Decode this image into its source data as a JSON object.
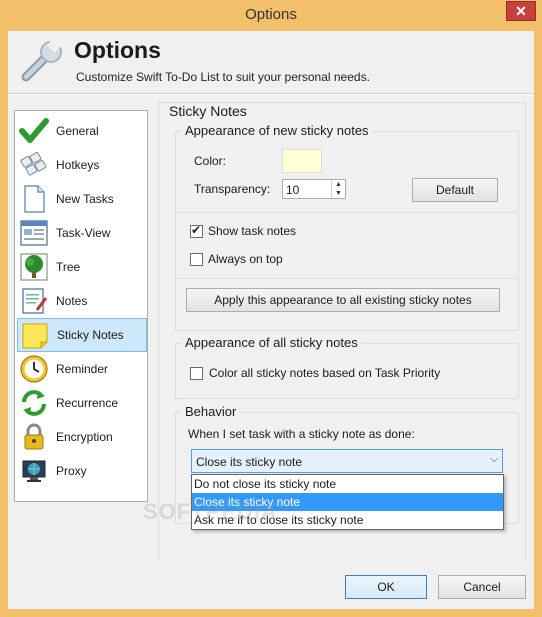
{
  "window": {
    "title": "Options",
    "close_label": "✕"
  },
  "header": {
    "title": "Options",
    "subtitle": "Customize Swift To-Do List to suit your personal needs."
  },
  "nav": {
    "items": [
      {
        "label": "General",
        "icon": "checkmark-icon"
      },
      {
        "label": "Hotkeys",
        "icon": "keyboard-icon"
      },
      {
        "label": "New Tasks",
        "icon": "new-document-icon"
      },
      {
        "label": "Task-View",
        "icon": "task-view-icon"
      },
      {
        "label": "Tree",
        "icon": "tree-icon"
      },
      {
        "label": "Notes",
        "icon": "notes-icon"
      },
      {
        "label": "Sticky Notes",
        "icon": "sticky-note-icon"
      },
      {
        "label": "Reminder",
        "icon": "clock-icon"
      },
      {
        "label": "Recurrence",
        "icon": "recurrence-icon"
      },
      {
        "label": "Encryption",
        "icon": "lock-icon"
      },
      {
        "label": "Proxy",
        "icon": "monitor-globe-icon"
      }
    ],
    "selected": "Sticky Notes"
  },
  "panel": {
    "title": "Sticky Notes",
    "appearance_new": {
      "title": "Appearance of new sticky notes",
      "color_label": "Color:",
      "color_value": "#ffffd6",
      "transparency_label": "Transparency:",
      "transparency_value": "10",
      "default_button": "Default",
      "show_task_notes_label": "Show task notes",
      "show_task_notes_checked": true,
      "always_on_top_label": "Always on top",
      "always_on_top_checked": false,
      "apply_button": "Apply this appearance to all existing sticky notes"
    },
    "appearance_all": {
      "title": "Appearance of all sticky notes",
      "color_priority_label": "Color all sticky notes based on Task Priority",
      "color_priority_checked": false
    },
    "behavior": {
      "title": "Behavior",
      "prompt": "When I set task with a sticky note as done:",
      "selected": "Close its sticky note",
      "options": [
        "Do not close its sticky note",
        "Close its sticky note",
        "Ask me if to close its sticky note"
      ]
    }
  },
  "footer": {
    "ok_label": "OK",
    "cancel_label": "Cancel"
  },
  "watermark": "SOFTPEDIA",
  "colors": {
    "frame": "#f2bf6b",
    "selection": "#3399ff",
    "nav_selected": "#cde8fa"
  }
}
